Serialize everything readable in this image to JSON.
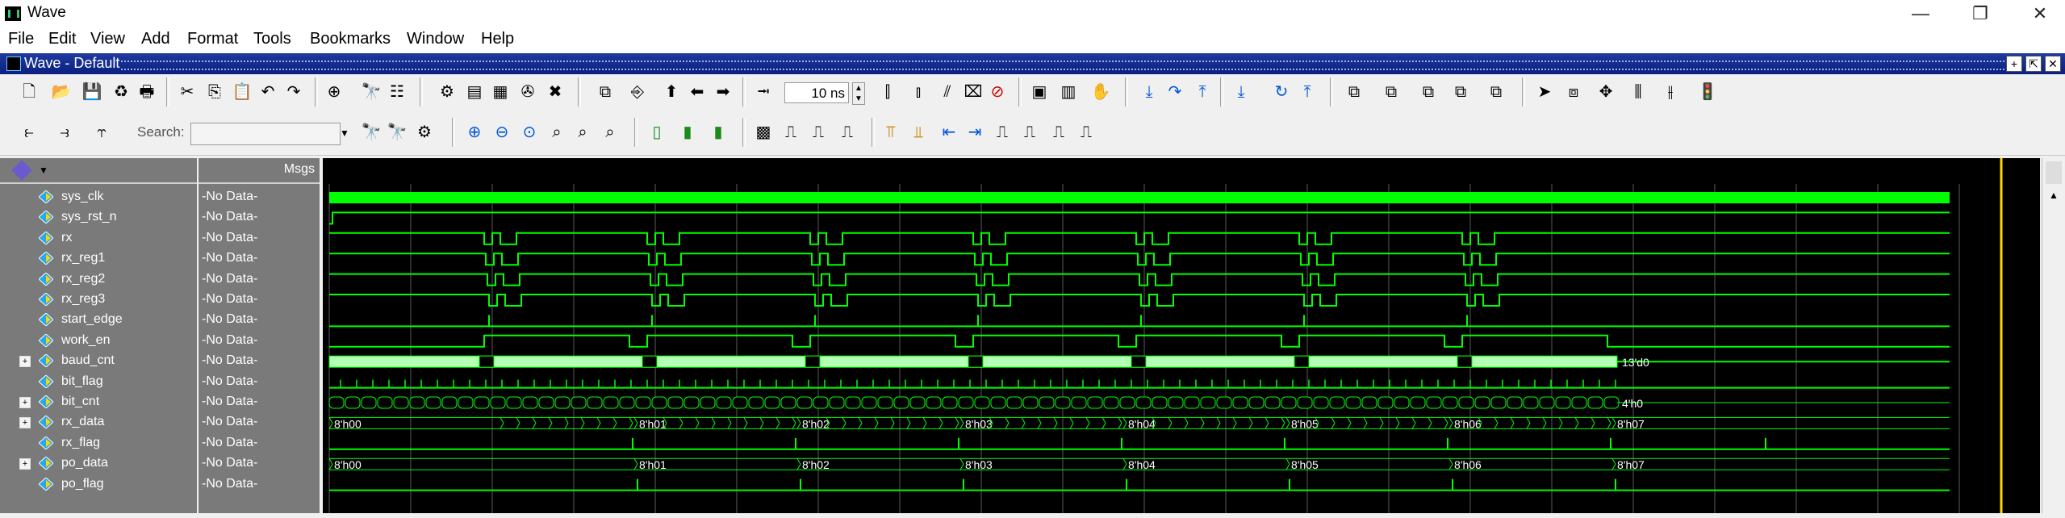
{
  "window": {
    "title": "Wave",
    "minimize": "—",
    "maximize": "❐",
    "close": "✕"
  },
  "menu": [
    "File",
    "Edit",
    "View",
    "Add",
    "Format",
    "Tools",
    "Bookmarks",
    "Window",
    "Help"
  ],
  "pane": {
    "title": "Wave - Default"
  },
  "toolbar": {
    "step_value": "10",
    "step_unit": "ns",
    "search_label": "Search:",
    "search_placeholder": ""
  },
  "columns": {
    "msgs": "Msgs"
  },
  "colors": {
    "wave": "#00ff00",
    "bus_fill": "#b6ffb6",
    "cursor": "#ffd700"
  },
  "signals": [
    {
      "name": "sys_clk",
      "value": "-No Data-",
      "kind": "clock",
      "expandable": false
    },
    {
      "name": "sys_rst_n",
      "value": "-No Data-",
      "kind": "bit",
      "expandable": false
    },
    {
      "name": "rx",
      "value": "-No Data-",
      "kind": "bit",
      "expandable": false
    },
    {
      "name": "rx_reg1",
      "value": "-No Data-",
      "kind": "bit",
      "expandable": false
    },
    {
      "name": "rx_reg2",
      "value": "-No Data-",
      "kind": "bit",
      "expandable": false
    },
    {
      "name": "rx_reg3",
      "value": "-No Data-",
      "kind": "bit",
      "expandable": false
    },
    {
      "name": "start_edge",
      "value": "-No Data-",
      "kind": "bit",
      "expandable": false
    },
    {
      "name": "work_en",
      "value": "-No Data-",
      "kind": "bit",
      "expandable": false
    },
    {
      "name": "baud_cnt",
      "value": "-No Data-",
      "kind": "bus",
      "expandable": true
    },
    {
      "name": "bit_flag",
      "value": "-No Data-",
      "kind": "bit",
      "expandable": false
    },
    {
      "name": "bit_cnt",
      "value": "-No Data-",
      "kind": "bus",
      "expandable": true
    },
    {
      "name": "rx_data",
      "value": "-No Data-",
      "kind": "bus",
      "expandable": true
    },
    {
      "name": "rx_flag",
      "value": "-No Data-",
      "kind": "bit",
      "expandable": false
    },
    {
      "name": "po_data",
      "value": "-No Data-",
      "kind": "bus",
      "expandable": true
    },
    {
      "name": "po_flag",
      "value": "-No Data-",
      "kind": "bit",
      "expandable": false
    }
  ],
  "bus_labels": {
    "baud_cnt_end": "13'd0",
    "bit_cnt_end": "4'h0",
    "rx_data": [
      "8'h00",
      "8'h01",
      "8'h02",
      "8'h03",
      "8'h04",
      "8'h05",
      "8'h06",
      "8'h07"
    ],
    "po_data": [
      "8'h00",
      "8'h01",
      "8'h02",
      "8'h03",
      "8'h04",
      "8'h05",
      "8'h06",
      "8'h07"
    ]
  },
  "icons": {
    "toolbar1": [
      "new-icon",
      "open-icon",
      "save-icon",
      "reload-icon",
      "print-icon",
      "cut-icon",
      "copy-icon",
      "paste-icon",
      "undo-icon",
      "redo-icon",
      "add-icon",
      "find-icon",
      "format-icon",
      "compile-icon",
      "simulate-icon",
      "list-icon",
      "break-icon",
      "stop-icon",
      "zoom-in-group-icon",
      "insert-icon",
      "up-icon",
      "left-icon",
      "right-icon",
      "step-icon"
    ],
    "toolbar2": [
      "wave-icon",
      "run-icon",
      "step-over-icon",
      "continue-icon",
      "restart-icon",
      "restore-icon",
      "pointer-icon",
      "zoom-icon",
      "pan-icon",
      "measure-icon",
      "cursor-icon",
      "log-icon"
    ]
  }
}
